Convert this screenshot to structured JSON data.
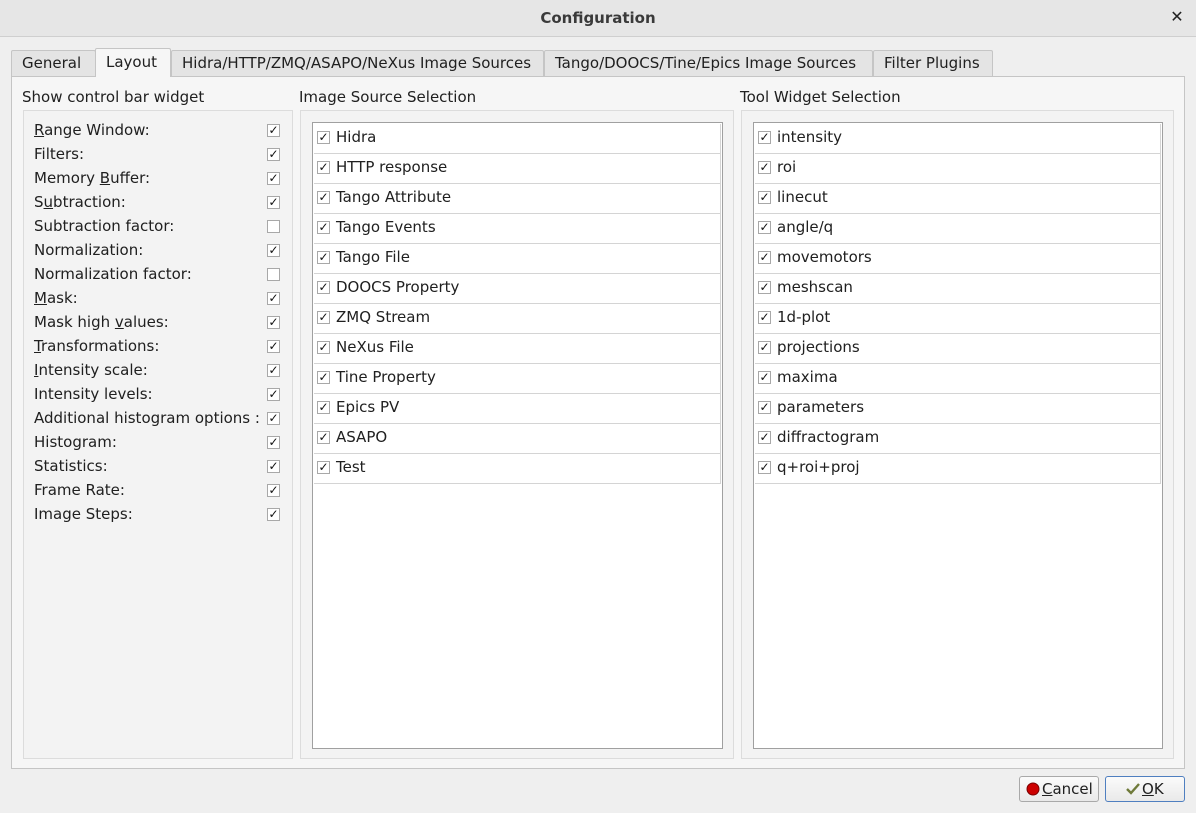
{
  "window": {
    "title": "Configuration"
  },
  "tabs": [
    {
      "label": "General",
      "active": false
    },
    {
      "label": "Layout",
      "active": true
    },
    {
      "label": "Hidra/HTTP/ZMQ/ASAPO/NeXus Image Sources",
      "active": false
    },
    {
      "label": "Tango/DOOCS/Tine/Epics Image Sources",
      "active": false
    },
    {
      "label": "Filter Plugins",
      "active": false
    }
  ],
  "control_bar": {
    "title": "Show control bar widget",
    "items": [
      {
        "label": "Range Window:",
        "mnemonic": "R",
        "checked": true
      },
      {
        "label": "Filters:",
        "mnemonic": "",
        "checked": true
      },
      {
        "label": "Memory Buffer:",
        "mnemonic": "B",
        "checked": true
      },
      {
        "label": "Subtraction:",
        "mnemonic": "u",
        "checked": true
      },
      {
        "label": "Subtraction factor:",
        "mnemonic": "",
        "checked": false
      },
      {
        "label": "Normalization:",
        "mnemonic": "",
        "checked": true
      },
      {
        "label": "Normalization factor:",
        "mnemonic": "",
        "checked": false
      },
      {
        "label": "Mask:",
        "mnemonic": "M",
        "checked": true
      },
      {
        "label": "Mask high values:",
        "mnemonic": "v",
        "checked": true
      },
      {
        "label": "Transformations:",
        "mnemonic": "T",
        "checked": true
      },
      {
        "label": "Intensity scale:",
        "mnemonic": "I",
        "checked": true
      },
      {
        "label": "Intensity levels:",
        "mnemonic": "",
        "checked": true
      },
      {
        "label": "Additional histogram options :",
        "mnemonic": "",
        "checked": true
      },
      {
        "label": "Histogram:",
        "mnemonic": "",
        "checked": true
      },
      {
        "label": "Statistics:",
        "mnemonic": "",
        "checked": true
      },
      {
        "label": "Frame Rate:",
        "mnemonic": "",
        "checked": true
      },
      {
        "label": "Image Steps:",
        "mnemonic": "",
        "checked": true
      }
    ]
  },
  "image_sources": {
    "title": "Image Source Selection",
    "items": [
      {
        "label": "Hidra",
        "checked": true
      },
      {
        "label": "HTTP response",
        "checked": true
      },
      {
        "label": "Tango Attribute",
        "checked": true
      },
      {
        "label": "Tango Events",
        "checked": true
      },
      {
        "label": "Tango File",
        "checked": true
      },
      {
        "label": "DOOCS Property",
        "checked": true
      },
      {
        "label": "ZMQ Stream",
        "checked": true
      },
      {
        "label": "NeXus File",
        "checked": true
      },
      {
        "label": "Tine Property",
        "checked": true
      },
      {
        "label": "Epics PV",
        "checked": true
      },
      {
        "label": "ASAPO",
        "checked": true
      },
      {
        "label": "Test",
        "checked": true
      }
    ]
  },
  "tool_widgets": {
    "title": "Tool Widget Selection",
    "items": [
      {
        "label": "intensity",
        "checked": true
      },
      {
        "label": "roi",
        "checked": true
      },
      {
        "label": "linecut",
        "checked": true
      },
      {
        "label": "angle/q",
        "checked": true
      },
      {
        "label": "movemotors",
        "checked": true
      },
      {
        "label": "meshscan",
        "checked": true
      },
      {
        "label": "1d-plot",
        "checked": true
      },
      {
        "label": "projections",
        "checked": true
      },
      {
        "label": "maxima",
        "checked": true
      },
      {
        "label": "parameters",
        "checked": true
      },
      {
        "label": "diffractogram",
        "checked": true
      },
      {
        "label": "q+roi+proj",
        "checked": true
      }
    ]
  },
  "buttons": {
    "cancel": {
      "label": "Cancel",
      "mnemonic": "C",
      "icon": "red-circle-icon"
    },
    "ok": {
      "label": "OK",
      "mnemonic": "O",
      "icon": "checkmark-icon"
    }
  },
  "colors": {
    "accent": "#4f7fc0",
    "cancel_icon": "#cc0000",
    "ok_icon": "#6f7a3a"
  }
}
